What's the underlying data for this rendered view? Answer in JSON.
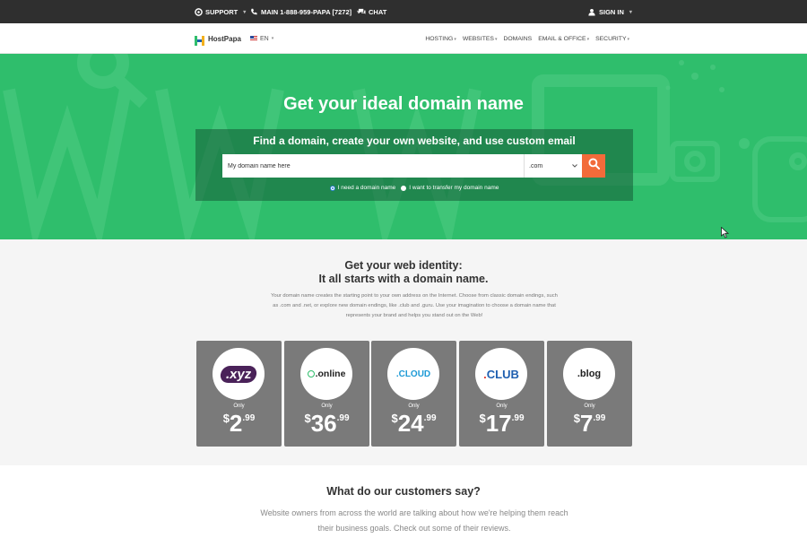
{
  "topbar": {
    "support": "SUPPORT",
    "phone": "MAIN 1-888-959-PAPA [7272]",
    "chat": "CHAT",
    "signin": "SIGN IN"
  },
  "nav": {
    "brand": "HostPapa",
    "lang": "EN",
    "links": [
      "HOSTING",
      "WEBSITES",
      "DOMAINS",
      "EMAIL & OFFICE",
      "SECURITY"
    ]
  },
  "hero": {
    "title": "Get your ideal domain name",
    "panel_title": "Find a domain, create your own website, and use custom email",
    "search_placeholder": "My domain name here",
    "tld": ".com",
    "radio_need": "I need a domain name",
    "radio_transfer": "I want to transfer my domain name"
  },
  "domains": {
    "title_line1": "Get your web identity:",
    "title_line2": "It all starts with a domain name.",
    "description": "Your domain name creates the starting point to your own address on the Internet. Choose from classic domain endings, such as .com and .net, or explore new domain endings, like .club and .guru. Use your imagination to choose a domain name that represents your brand and helps you stand out on the Web!",
    "cards": [
      {
        "tld": ".xyz",
        "only": "Only",
        "currency": "$",
        "dollars": "2",
        "cents": ".99"
      },
      {
        "tld": ".online",
        "only": "Only",
        "currency": "$",
        "dollars": "36",
        "cents": ".99"
      },
      {
        "tld": ".CLOUD",
        "only": "Only",
        "currency": "$",
        "dollars": "24",
        "cents": ".99"
      },
      {
        "tld": ".CLUB",
        "only": "Only",
        "currency": "$",
        "dollars": "17",
        "cents": ".99"
      },
      {
        "tld": ".blog",
        "only": "Only",
        "currency": "$",
        "dollars": "7",
        "cents": ".99"
      }
    ]
  },
  "testimonials": {
    "title": "What do our customers say?",
    "description": "Website owners from across the world are talking about how we're helping them reach their business goals. Check out some of their reviews."
  },
  "colors": {
    "hero_green": "#2fbe6c",
    "search_button": "#f26b3a",
    "topbar": "#2f2f2f",
    "card_gray": "#7a7a7a"
  },
  "icons": [
    "support-icon",
    "phone-icon",
    "chat-icon",
    "user-icon",
    "search-icon",
    "chevron-down-icon",
    "mouse-cursor-icon"
  ]
}
